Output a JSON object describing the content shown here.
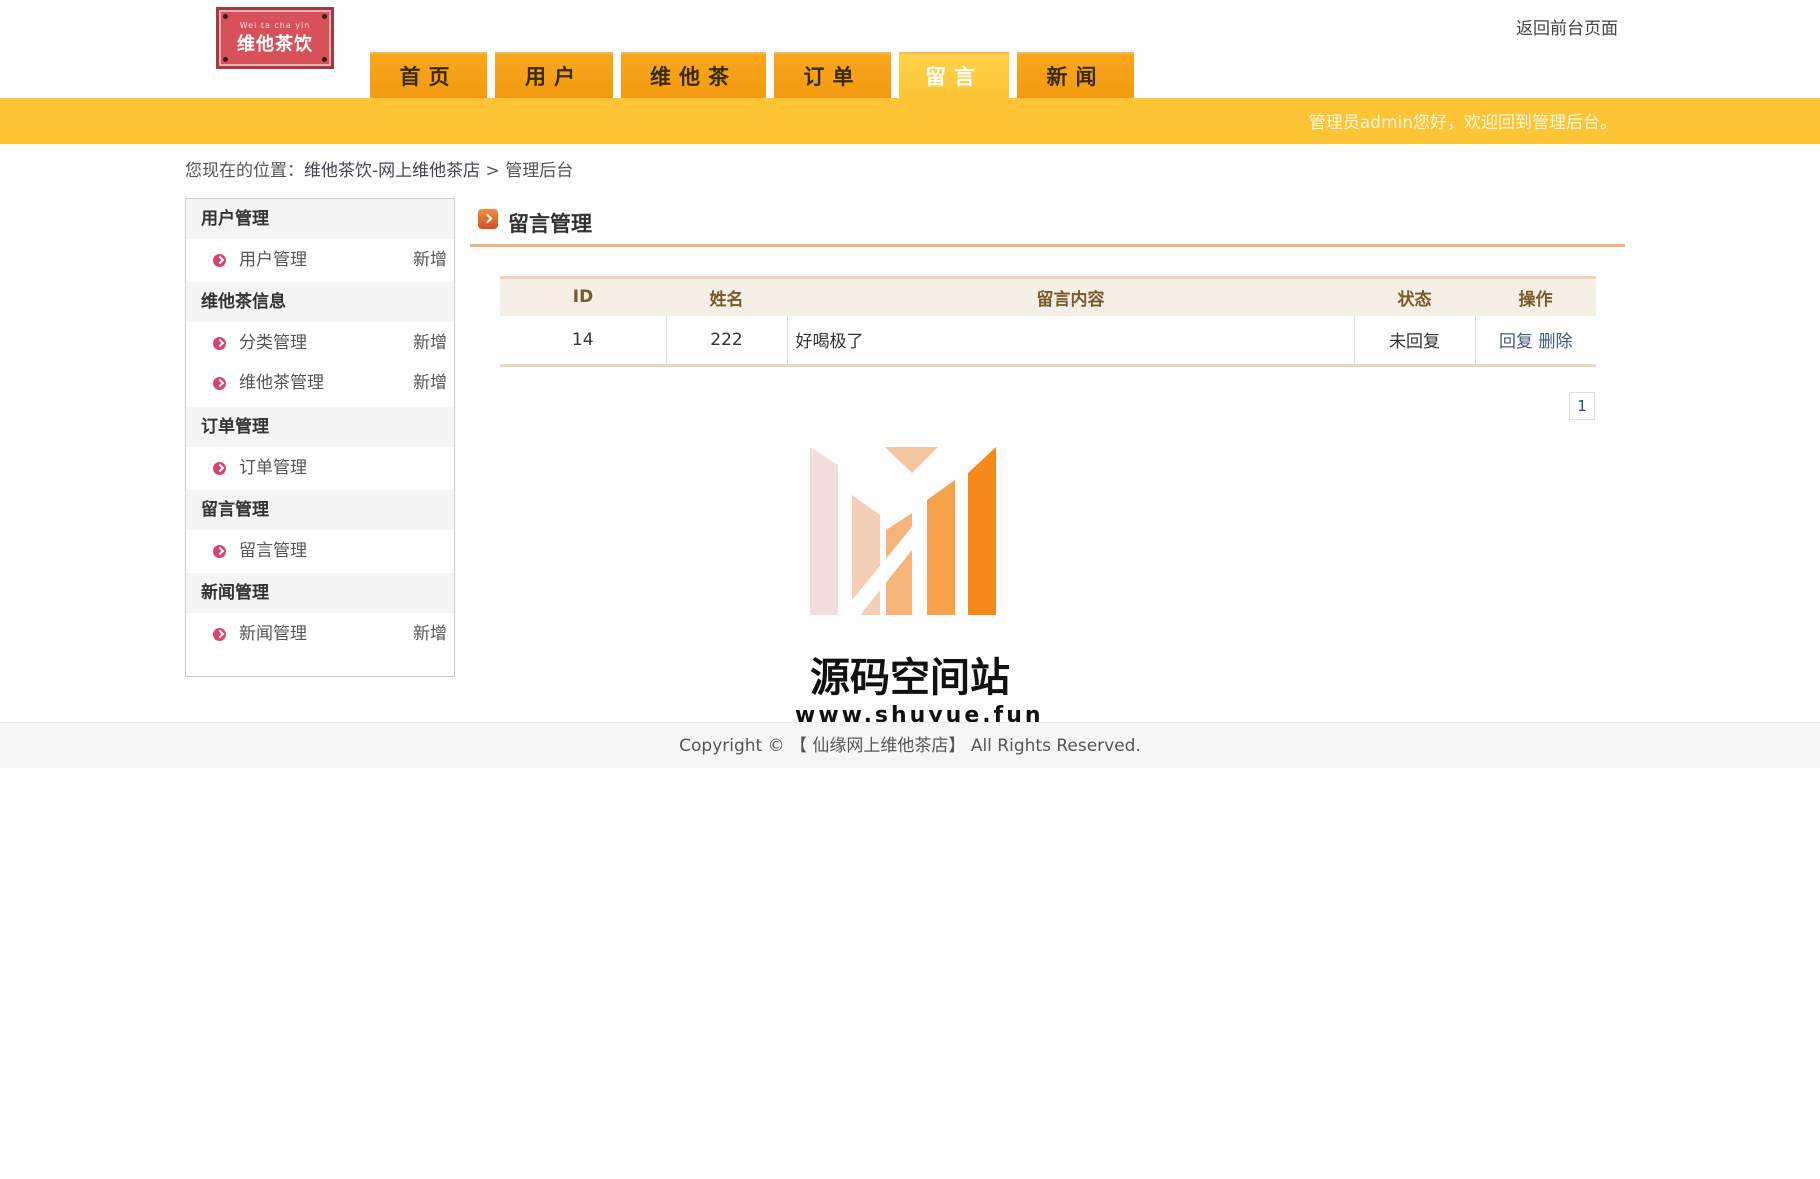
{
  "header": {
    "logo_small": "Wei ta cha yin",
    "logo_text": "维他茶饮",
    "back_link": "返回前台页面"
  },
  "nav": {
    "tabs": [
      "首页",
      "用户",
      "维他茶",
      "订单",
      "留言",
      "新闻"
    ],
    "active": "留言"
  },
  "banner": {
    "welcome": "管理员admin您好，欢迎回到管理后台。"
  },
  "breadcrumb": {
    "prefix": "您现在的位置：",
    "site": "维他茶饮-网上维他茶店",
    "sep": ">",
    "current": "管理后台"
  },
  "sidebar": {
    "groups": [
      {
        "title": "用户管理",
        "items": [
          {
            "label": "用户管理",
            "add": "新增"
          }
        ]
      },
      {
        "title": "维他茶信息",
        "items": [
          {
            "label": "分类管理",
            "add": "新增"
          },
          {
            "label": "维他茶管理",
            "add": "新增"
          }
        ]
      },
      {
        "title": "订单管理",
        "items": [
          {
            "label": "订单管理",
            "add": ""
          }
        ]
      },
      {
        "title": "留言管理",
        "items": [
          {
            "label": "留言管理",
            "add": ""
          }
        ]
      },
      {
        "title": "新闻管理",
        "items": [
          {
            "label": "新闻管理",
            "add": "新增"
          }
        ]
      }
    ]
  },
  "main": {
    "title": "留言管理",
    "table": {
      "headers": [
        "ID",
        "姓名",
        "留言内容",
        "状态",
        "操作"
      ],
      "rows": [
        {
          "id": "14",
          "name": "222",
          "content": "好喝极了",
          "status": "未回复",
          "reply": "回复",
          "delete": "删除"
        }
      ]
    },
    "pager": "1"
  },
  "watermark": {
    "title": "源码空间站",
    "url": "www.shuyue.fun"
  },
  "footer": {
    "text": "Copyright © 【 仙缘网上维他茶店】 All Rights Reserved."
  },
  "colors": {
    "nav_orange": "#f39a10",
    "banner_yellow": "#fdc535",
    "bullet_pink": "#d9446e"
  }
}
